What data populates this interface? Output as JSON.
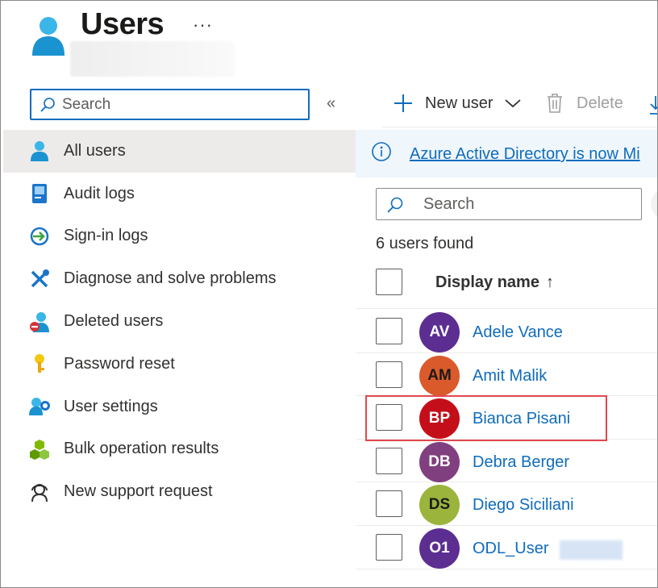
{
  "header": {
    "title": "Users",
    "more_label": "···"
  },
  "nav": {
    "search_placeholder": "Search",
    "collapse_label": "«",
    "items": [
      {
        "label": "All users",
        "icon": "user-icon",
        "active": true
      },
      {
        "label": "Audit logs",
        "icon": "audit-log-icon"
      },
      {
        "label": "Sign-in logs",
        "icon": "sign-in-icon"
      },
      {
        "label": "Diagnose and solve problems",
        "icon": "wrench-icon"
      },
      {
        "label": "Deleted users",
        "icon": "deleted-user-icon"
      },
      {
        "label": "Password reset",
        "icon": "key-icon"
      },
      {
        "label": "User settings",
        "icon": "user-settings-icon"
      },
      {
        "label": "Bulk operation results",
        "icon": "cubes-icon"
      },
      {
        "label": "New support request",
        "icon": "support-icon"
      }
    ]
  },
  "toolbar": {
    "new_user_label": "New user",
    "delete_label": "Delete"
  },
  "banner": {
    "text": "Azure Active Directory is now Mi"
  },
  "users": {
    "search_placeholder": "Search",
    "count_text": "6 users found",
    "column_display_name": "Display name",
    "sort_indicator": "↑",
    "rows": [
      {
        "initials": "AV",
        "name": "Adele Vance",
        "color": "#5c2e91"
      },
      {
        "initials": "AM",
        "name": "Amit Malik",
        "color": "#da5a2b"
      },
      {
        "initials": "BP",
        "name": "Bianca Pisani",
        "color": "#c40f1a"
      },
      {
        "initials": "DB",
        "name": "Debra Berger",
        "color": "#803f7f"
      },
      {
        "initials": "DS",
        "name": "Diego Siciliani",
        "color": "#9ab43c"
      },
      {
        "initials": "O1",
        "name": "ODL_User",
        "color": "#5c2e91"
      }
    ]
  },
  "colors": {
    "accent": "#0f6cbd",
    "highlight": "#e0484e",
    "active_nav": "#edebe9"
  }
}
